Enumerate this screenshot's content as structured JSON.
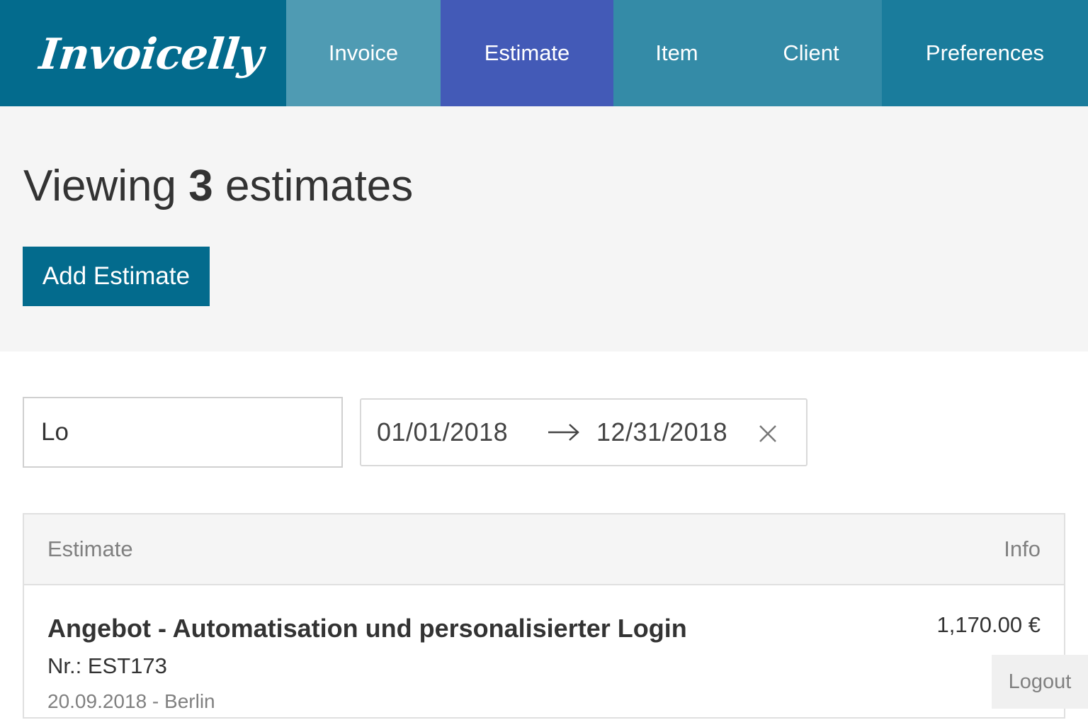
{
  "brand": {
    "logo_text": "Invoicelly"
  },
  "nav": {
    "items": [
      {
        "label": "Invoice"
      },
      {
        "label": "Estimate"
      },
      {
        "label": "Item"
      },
      {
        "label": "Client"
      },
      {
        "label": "Preferences"
      }
    ],
    "active": "Estimate",
    "colors": {
      "logo_bg": "#036b8d",
      "invoice": "#4f9bb3",
      "estimate_active": "#435ab7",
      "item": "#348ba7",
      "client": "#348ba7",
      "preferences": "#1a7c9c"
    }
  },
  "header": {
    "title_prefix": "Viewing",
    "count": "3",
    "title_suffix": "estimates",
    "add_button_label": "Add Estimate"
  },
  "filters": {
    "search_value": "Lo",
    "date_start": "01/01/2018",
    "date_end": "12/31/2018",
    "arrow_icon": "arrow-right-icon",
    "clear_icon": "close-icon"
  },
  "table": {
    "columns": {
      "estimate": "Estimate",
      "info": "Info"
    },
    "rows": [
      {
        "title": "Angebot - Automatisation und personalisierter Login",
        "number": "Nr.: EST173",
        "meta": "20.09.2018 - Berlin",
        "amount": "1,170.00 €"
      }
    ]
  },
  "footer": {
    "logout_label": "Logout"
  }
}
